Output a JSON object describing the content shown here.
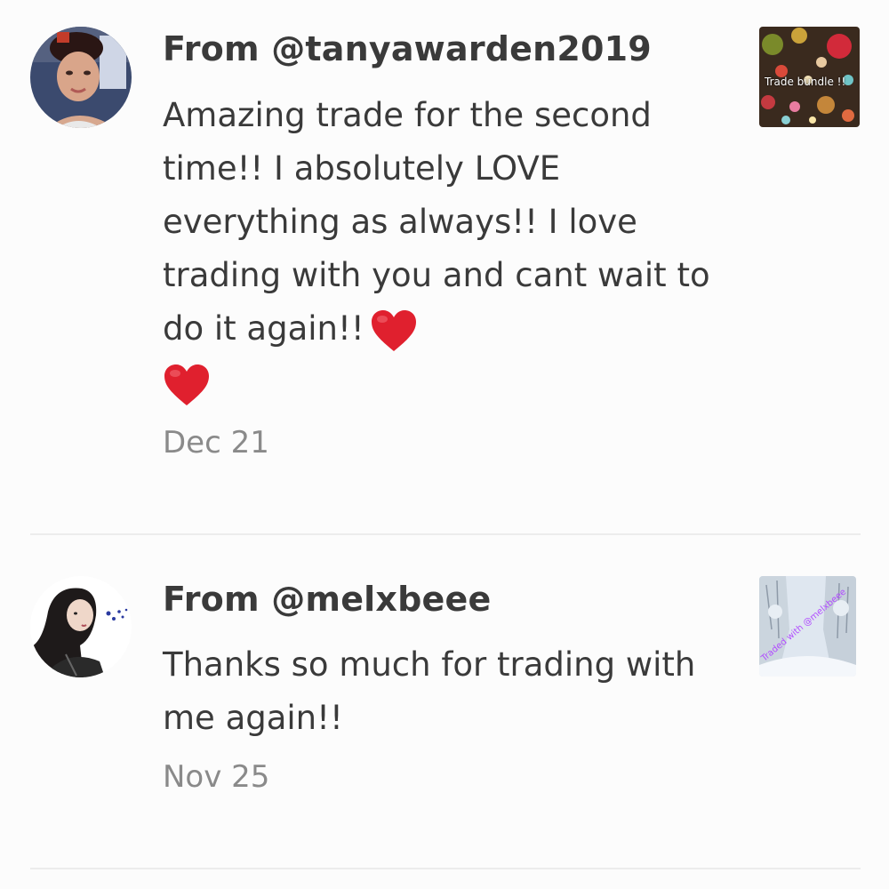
{
  "reviews": [
    {
      "from": "From @tanyawarden2019",
      "comment": "Amazing trade for the second time!! I absolutely LOVE everything as always!! I love trading with you and cant wait to do it again!!",
      "hearts": [
        "heart-emoji",
        "heart-emoji"
      ],
      "date": "Dec 21",
      "thumbnail_caption": "Trade bundle !!"
    },
    {
      "from": "From @melxbeee",
      "comment": "Thanks so much for trading with me again!!",
      "date": "Nov 25",
      "thumbnail_caption": "Traded with @melxbeee"
    }
  ],
  "colors": {
    "background": "#fcfcfc",
    "text": "#3a3a3a",
    "date": "#8a8a8a",
    "divider": "#ececec",
    "heart": "#e0202e"
  }
}
